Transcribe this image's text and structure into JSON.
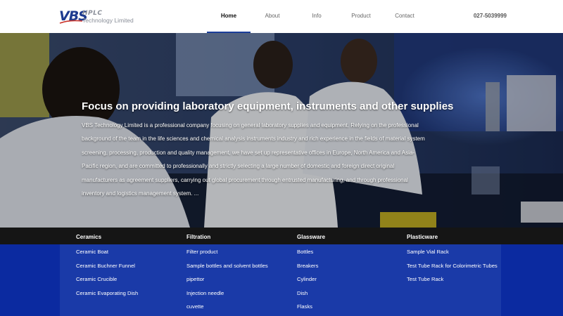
{
  "brand": {
    "logo_text": "VBS",
    "hplc": "HPLC",
    "company": "Technology Limited"
  },
  "nav": {
    "items": [
      {
        "label": "Home",
        "active": true
      },
      {
        "label": "About"
      },
      {
        "label": "Info"
      },
      {
        "label": "Product"
      },
      {
        "label": "Contact"
      }
    ],
    "phone": "027-5039999"
  },
  "hero": {
    "title": "Focus on providing laboratory equipment, instruments and other supplies",
    "text": "VBS Technology Limited is a professional company focusing on general laboratory supplies and equipment. Relying on the professional background of the team in the life sciences and chemical analysis instruments industry and rich experience in the fields of material system screening, processing, production and quality management, we have set up representative offices in Europe, North America and Asia-Pacific region, and are committed to professionally and strictly selecting a large number of domestic and foreign direct original manufacturers as agreement suppliers, carrying out global procurement through entrusted manufacturing, and through professional inventory and logistics management system. ..."
  },
  "categories": [
    {
      "title": "Ceramics",
      "items": [
        "Ceramic Boat",
        "Ceramic Buchner Funnel",
        "Ceramic Crucible",
        "Ceramic Evaporating Dish"
      ]
    },
    {
      "title": "Filtration",
      "items": [
        "Filter product",
        "Sample bottles and solvent bottles",
        "pipettor",
        "Injection needle",
        "cuvette"
      ]
    },
    {
      "title": "Glassware",
      "items": [
        "Bottles",
        "Breakers",
        "Cylinder",
        "Dish",
        "Flasks"
      ]
    },
    {
      "title": "Plasticware",
      "items": [
        "Sample Vial Rack",
        "Test Tube Rack for Colorimetric Tubes",
        "Test Tube Rack"
      ]
    }
  ],
  "colors": {
    "brand_blue": "#1d3b8f",
    "nav_active_underline": "#1a3d99",
    "category_bar": "#151515",
    "category_panel": "#1a3aa8",
    "category_background": "#0b2aa0"
  }
}
